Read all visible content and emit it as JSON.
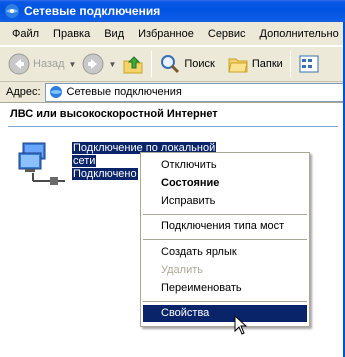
{
  "window": {
    "title": "Сетевые подключения"
  },
  "menu": [
    "Файл",
    "Правка",
    "Вид",
    "Избранное",
    "Сервис",
    "Дополнительно"
  ],
  "toolbar": {
    "back": "Назад",
    "search": "Поиск",
    "folders": "Папки"
  },
  "address": {
    "label": "Адрес:",
    "value": "Сетевые подключения"
  },
  "group": {
    "header": "ЛВС или высокоскоростной Интернет"
  },
  "connection": {
    "line1": "Подключение по локальной",
    "line2": "сети",
    "line3": "Подключено"
  },
  "context_menu": {
    "items": [
      "Отключить",
      "Состояние",
      "Исправить",
      "Подключения типа мост",
      "Создать ярлык",
      "Удалить",
      "Переименовать",
      "Свойства"
    ]
  },
  "colors": {
    "titlebar": "#0053e1",
    "selection": "#0a246a",
    "chrome": "#ece9d8"
  }
}
